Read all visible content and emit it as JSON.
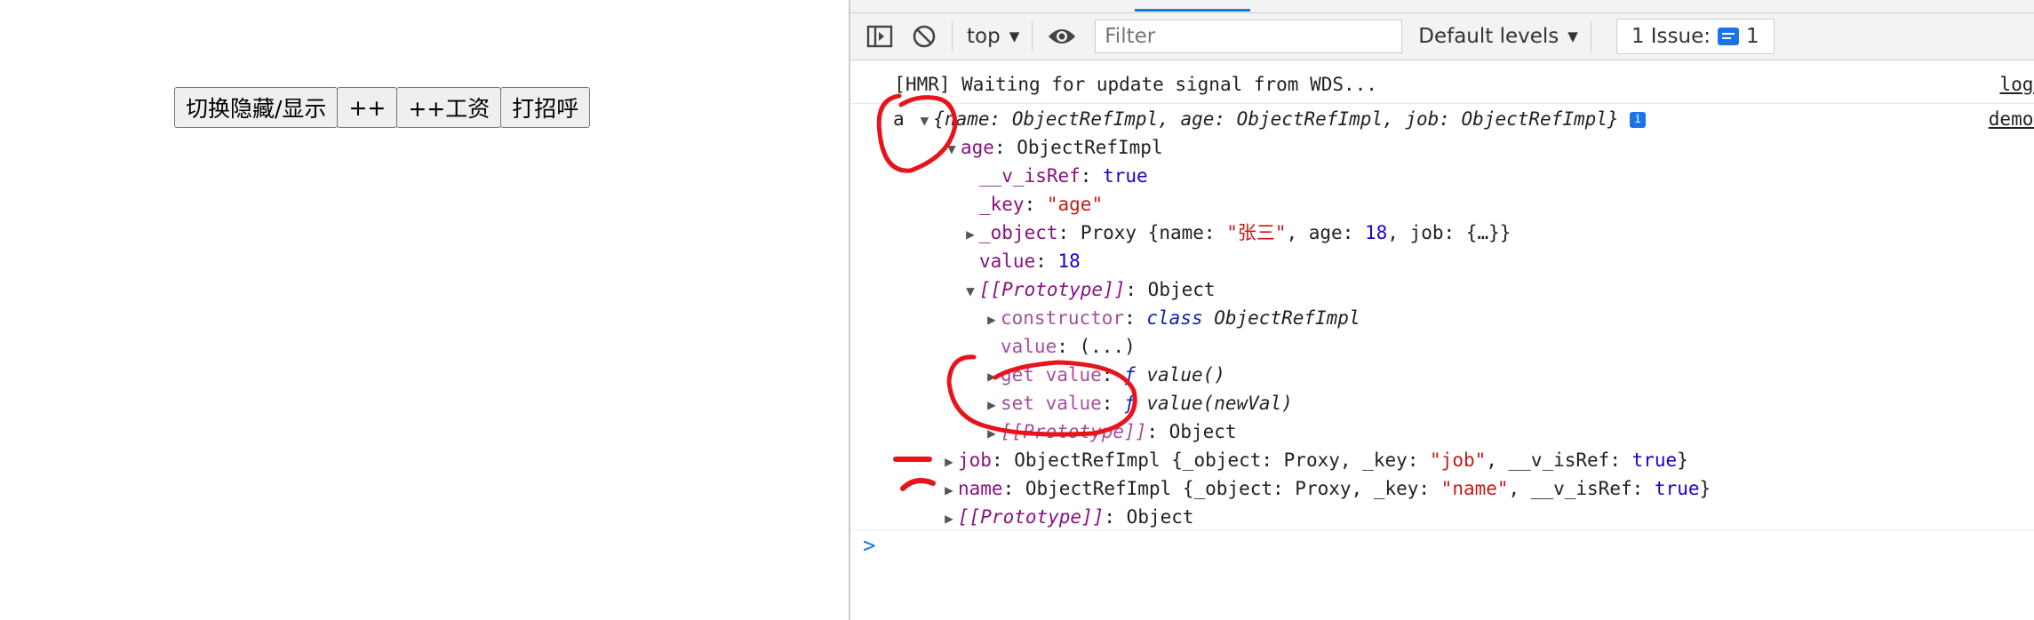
{
  "page": {
    "buttons": [
      "切换隐藏/显示",
      "++",
      "++工资",
      "打招呼"
    ]
  },
  "devtools": {
    "toolbar": {
      "context": "top",
      "filter_placeholder": "Filter",
      "levels": "Default levels",
      "issues_label": "1 Issue:",
      "issues_count": "1"
    },
    "console": {
      "hmr_message": "[HMR] Waiting for update signal from WDS...",
      "hmr_source": "log.",
      "log_label": "a",
      "log_source": "demo.",
      "summary": "{name: ObjectRefImpl, age: ObjectRefImpl, job: ObjectRefImpl}",
      "age_key": "age",
      "age_type": "ObjectRefImpl",
      "v_isRef_key": "__v_isRef",
      "v_isRef_val": "true",
      "key_key": "_key",
      "key_val": "\"age\"",
      "object_key": "_object",
      "object_type": "Proxy ",
      "object_open": "{name: ",
      "object_name_val": "\"张三\"",
      "object_age": ", age: ",
      "object_age_val": "18",
      "object_rest": ", job: {…}}",
      "value_key": "value",
      "value_val": "18",
      "proto_key": "[[Prototype]]",
      "proto_val": "Object",
      "ctor_key": "constructor",
      "ctor_class": "class ",
      "ctor_name": "ObjectRefImpl",
      "value_getter_key": "value",
      "value_getter_val": "(...)",
      "get_key": "get value",
      "get_f": "ƒ ",
      "get_val": "value()",
      "set_key": "set value",
      "set_f": "ƒ ",
      "set_val": "value(newVal)",
      "inner_proto_key": "[[Prototype]]",
      "inner_proto_val": "Object",
      "job_key": "job",
      "job_type": "ObjectRefImpl {_object: Proxy, _key: ",
      "job_keyval": "\"job\"",
      "job_mid": ", __v_isRef: ",
      "job_true": "true",
      "job_end": "}",
      "name_key": "name",
      "name_type": "ObjectRefImpl {_object: Proxy, _key: ",
      "name_keyval": "\"name\"",
      "name_mid": ", __v_isRef: ",
      "name_true": "true",
      "name_end": "}",
      "outer_proto_key": "[[Prototype]]",
      "outer_proto_val": "Object",
      "prompt": ">"
    }
  },
  "colors": {
    "annotation_red": "#e8141c",
    "accent_blue": "#1a73e8"
  }
}
